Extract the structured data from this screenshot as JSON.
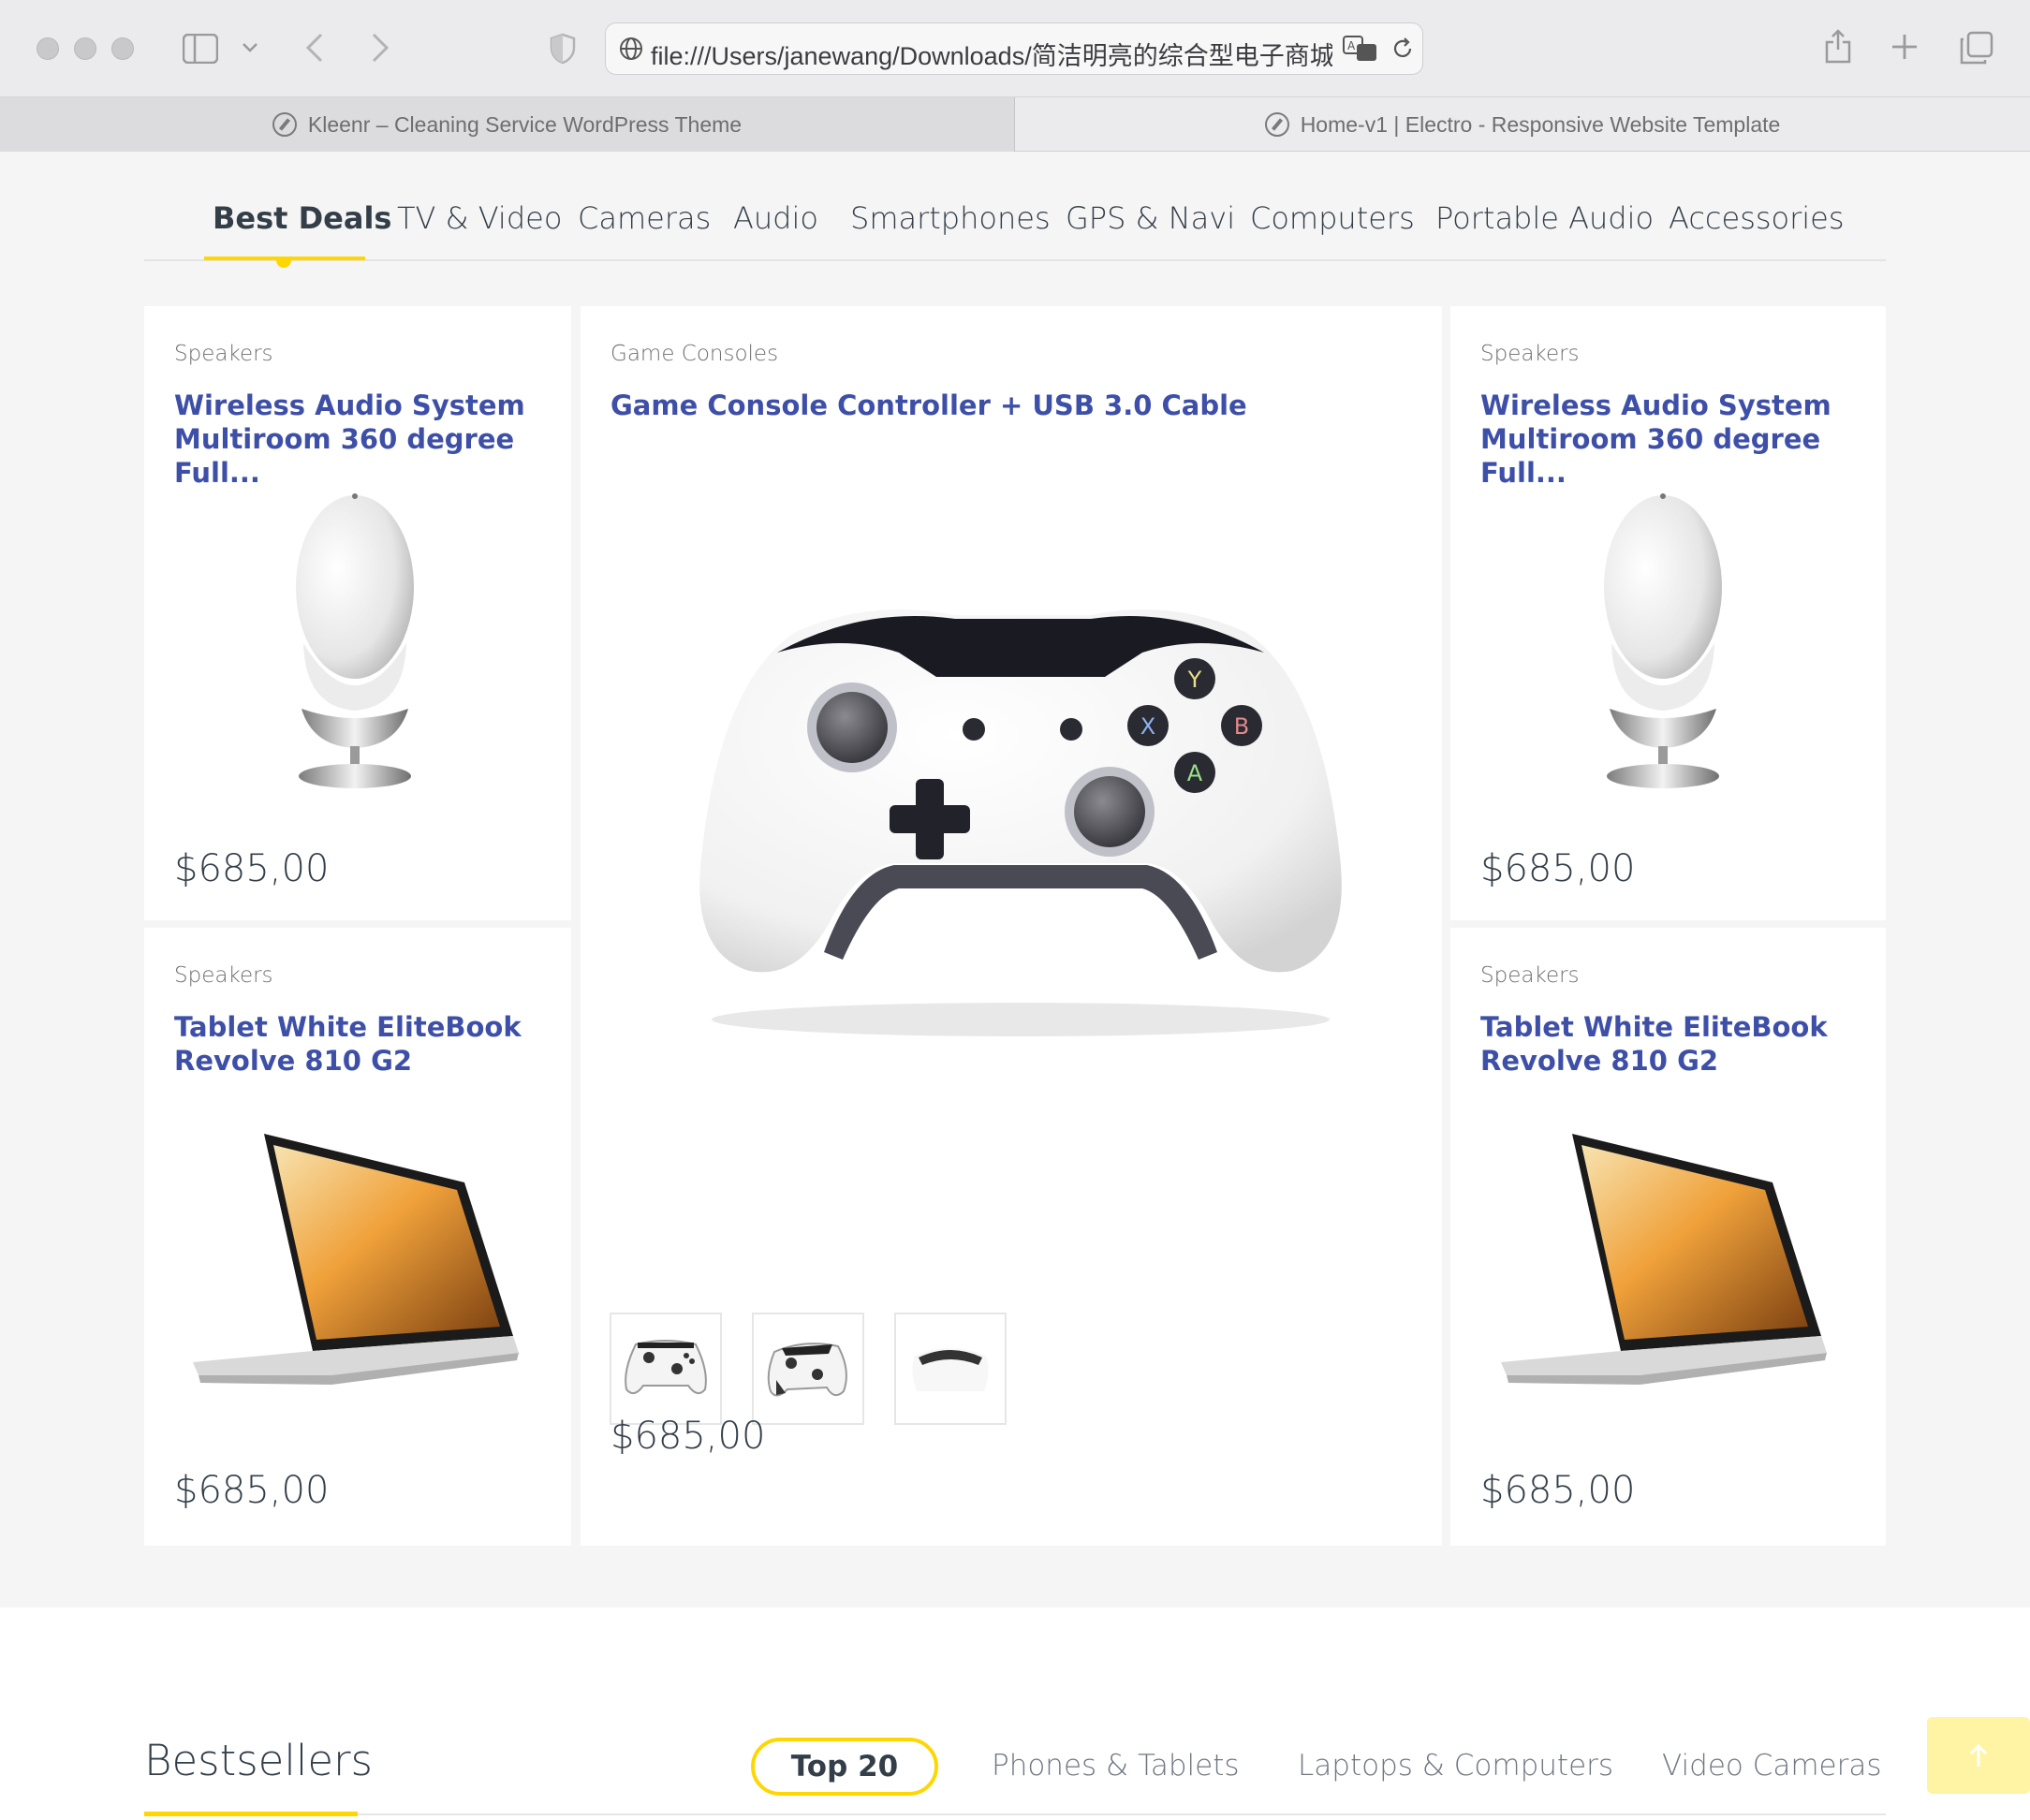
{
  "browser": {
    "url": "file:///Users/janewang/Downloads/简洁明亮的综合型电子商城",
    "tabs": [
      {
        "label": "Kleenr – Cleaning Service WordPress Theme",
        "active": true
      },
      {
        "label": "Home-v1 | Electro - Responsive Website Template",
        "active": false
      }
    ]
  },
  "category_nav": {
    "items": [
      "Best Deals",
      "TV & Video",
      "Cameras",
      "Audio",
      "Smartphones",
      "GPS & Navi",
      "Computers",
      "Portable Audio",
      "Accessories"
    ],
    "active": "Best Deals",
    "accent": "#fed700"
  },
  "products": {
    "left_top": {
      "category": "Speakers",
      "title": "Wireless Audio System Multiroom 360 degree Full...",
      "price": "$685,00",
      "image": "speaker-image"
    },
    "left_bottom": {
      "category": "Speakers",
      "title": "Tablet White EliteBook Revolve 810 G2",
      "price": "$685,00",
      "image": "laptop-image"
    },
    "featured": {
      "category": "Game Consoles",
      "title": "Game Console Controller + USB 3.0 Cable",
      "price": "$685,00",
      "image": "game-controller-image",
      "thumbnails": [
        "controller-thumb-front",
        "controller-thumb-angle",
        "controller-thumb-top"
      ]
    },
    "right_top": {
      "category": "Speakers",
      "title": "Wireless Audio System Multiroom 360 degree Full...",
      "price": "$685,00",
      "image": "speaker-image"
    },
    "right_bottom": {
      "category": "Speakers",
      "title": "Tablet White EliteBook Revolve 810 G2",
      "price": "$685,00",
      "image": "laptop-image"
    }
  },
  "bestsellers": {
    "title": "Bestsellers",
    "tabs": [
      "Top 20",
      "Phones & Tablets",
      "Laptops & Computers",
      "Video Cameras"
    ],
    "active": "Top 20"
  },
  "colors": {
    "link": "#3e4fa8",
    "text": "#333e48",
    "accent": "#fed700",
    "section_bg": "#f5f5f5"
  },
  "icons": [
    "sidebar-icon",
    "back-icon",
    "forward-icon",
    "shield-icon",
    "globe-icon",
    "translate-icon",
    "reload-icon",
    "share-icon",
    "new-tab-icon",
    "tab-overview-icon",
    "arrow-up-icon"
  ]
}
